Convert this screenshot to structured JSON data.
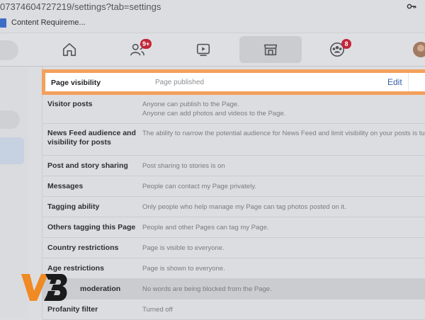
{
  "browser": {
    "url": "07374604727219/settings?tab=settings",
    "bookmark_label": "Content Requireme..."
  },
  "nav": {
    "friends_badge": "9+",
    "groups_badge": "8"
  },
  "highlighted": {
    "label": "Page visibility",
    "value": "Page published",
    "edit_label": "Edit"
  },
  "rows": [
    {
      "label": "Visitor posts",
      "value": "Anyone can publish to the Page.",
      "value2": "Anyone can add photos and videos to the Page."
    },
    {
      "label": "News Feed audience and",
      "label2": "visibility for posts",
      "value": "The ability to narrow the potential audience for News Feed and limit visibility on your posts is tur"
    },
    {
      "label": "Post and story sharing",
      "value": "Post sharing to stories is on"
    },
    {
      "label": "Messages",
      "value": "People can contact my Page privately."
    },
    {
      "label": "Tagging ability",
      "value": "Only people who help manage my Page can tag photos posted on it."
    },
    {
      "label": "Others tagging this Page",
      "value": "People and other Pages can tag my Page."
    },
    {
      "label": "Country restrictions",
      "value": "Page is visible to everyone."
    },
    {
      "label": "Age restrictions",
      "value": "Page is shown to everyone."
    },
    {
      "label": "moderation",
      "value": "No words are being blocked from the Page."
    },
    {
      "label": "Profanity filter",
      "value": "Turned off"
    }
  ],
  "colors": {
    "highlight_border": "#f3a05c",
    "badge": "#c2263a",
    "edit_link": "#355fab"
  }
}
